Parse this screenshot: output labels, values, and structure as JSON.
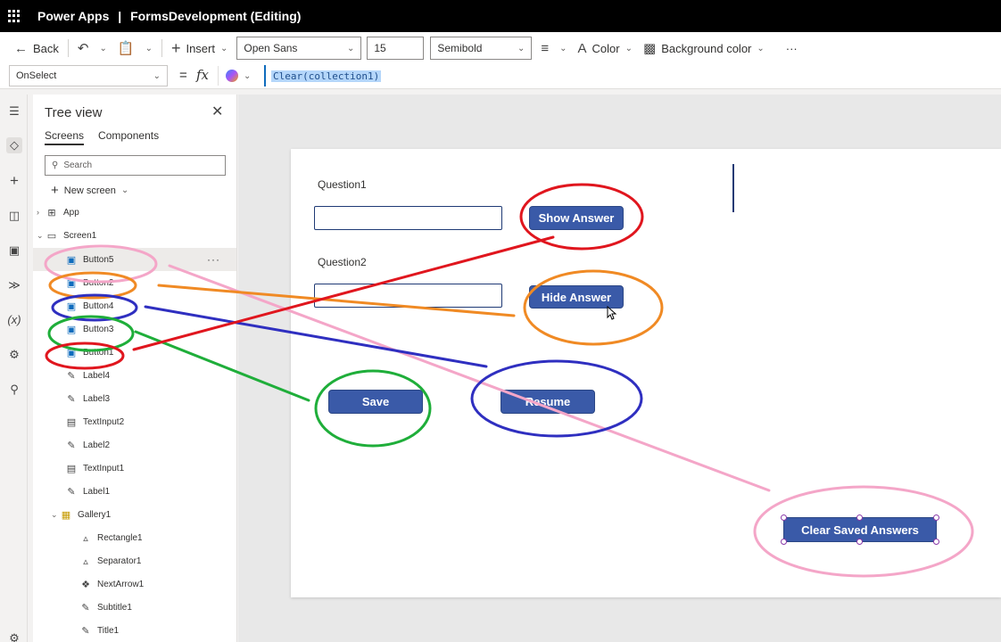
{
  "titlebar": {
    "app": "Power Apps",
    "separator": "|",
    "document": "FormsDevelopment (Editing)"
  },
  "cmdbar": {
    "back": "Back",
    "insert": "Insert",
    "font_family": "Open Sans",
    "font_size": "15",
    "font_weight": "Semibold",
    "color": "Color",
    "background_color": "Background color",
    "more": "···"
  },
  "formulabar": {
    "property": "OnSelect",
    "equals": "=",
    "fx": "fx",
    "formula": "Clear(collection1)"
  },
  "tree": {
    "title": "Tree view",
    "tabs": [
      "Screens",
      "Components"
    ],
    "search_placeholder": "Search",
    "new_screen": "New screen",
    "items": [
      {
        "label": "App"
      },
      {
        "label": "Screen1"
      },
      {
        "label": "Button5"
      },
      {
        "label": "Button2"
      },
      {
        "label": "Button4"
      },
      {
        "label": "Button3"
      },
      {
        "label": "Button1"
      },
      {
        "label": "Label4"
      },
      {
        "label": "Label3"
      },
      {
        "label": "TextInput2"
      },
      {
        "label": "Label2"
      },
      {
        "label": "TextInput1"
      },
      {
        "label": "Label1"
      },
      {
        "label": "Gallery1"
      },
      {
        "label": "Rectangle1"
      },
      {
        "label": "Separator1"
      },
      {
        "label": "NextArrow1"
      },
      {
        "label": "Subtitle1"
      },
      {
        "label": "Title1"
      }
    ]
  },
  "canvas": {
    "question1": "Question1",
    "question2": "Question2",
    "show_answer": "Show Answer",
    "hide_answer": "Hide Answer",
    "save": "Save",
    "resume": "Resume",
    "clear_saved": "Clear Saved Answers"
  },
  "colors": {
    "annotation_pink": "#f4a6c8",
    "annotation_orange": "#f08a24",
    "annotation_blue": "#2f2fc0",
    "annotation_green": "#1fae3a",
    "annotation_red": "#e0161e",
    "button_fill": "#3a5aa8"
  }
}
